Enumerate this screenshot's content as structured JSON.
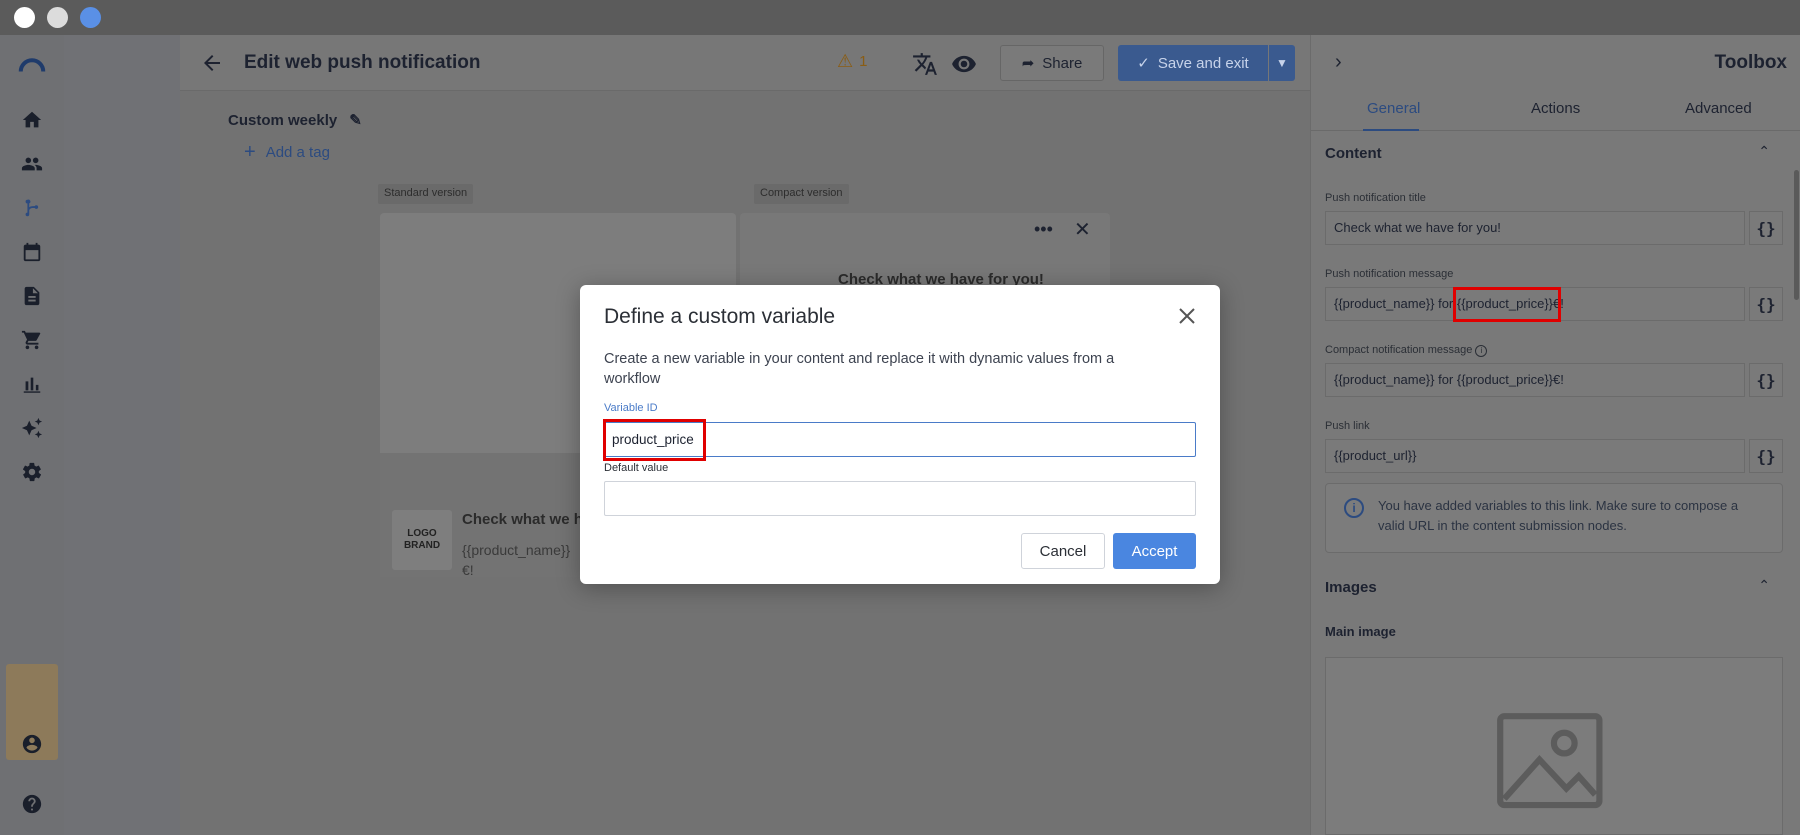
{
  "editor": {
    "title": "Edit web push notification",
    "warning_count": "1",
    "share_label": "Share",
    "save_label": "Save and exit",
    "campaign_name": "Custom weekly",
    "add_tag_label": "Add a tag",
    "standard_label": "Standard version",
    "compact_label": "Compact version",
    "logo_text": "LOGO\nBRAND",
    "preview_title": "Check what we ha",
    "preview_body": "{{product_name}}\n€!",
    "compact_title": "Check what we have for you!"
  },
  "toolbox": {
    "title": "Toolbox",
    "tabs": [
      "General",
      "Actions",
      "Advanced"
    ],
    "content_heading": "Content",
    "push_title_label": "Push notification title",
    "push_title_value": "Check what we have for you!",
    "push_message_label": "Push notification message",
    "push_message_value": "{{product_name}} for {{product_price}}€!",
    "compact_message_label": "Compact notification message",
    "compact_message_value": "{{product_name}} for {{product_price}}€!",
    "push_link_label": "Push link",
    "push_link_value": "{{product_url}}",
    "info_text": "You have added variables to this link. Make sure to compose a valid URL in the content submission nodes.",
    "images_heading": "Images",
    "main_image_label": "Main image",
    "var_btn": "{}"
  },
  "modal": {
    "title": "Define a custom variable",
    "description": "Create a new variable in your content and replace it with dynamic values from a workflow",
    "variable_id_label": "Variable ID",
    "variable_id_value": "product_price",
    "default_value_label": "Default value",
    "default_value_value": "",
    "cancel_label": "Cancel",
    "accept_label": "Accept"
  },
  "colors": {
    "accent": "#4a86e0",
    "highlight": "#e00000"
  }
}
